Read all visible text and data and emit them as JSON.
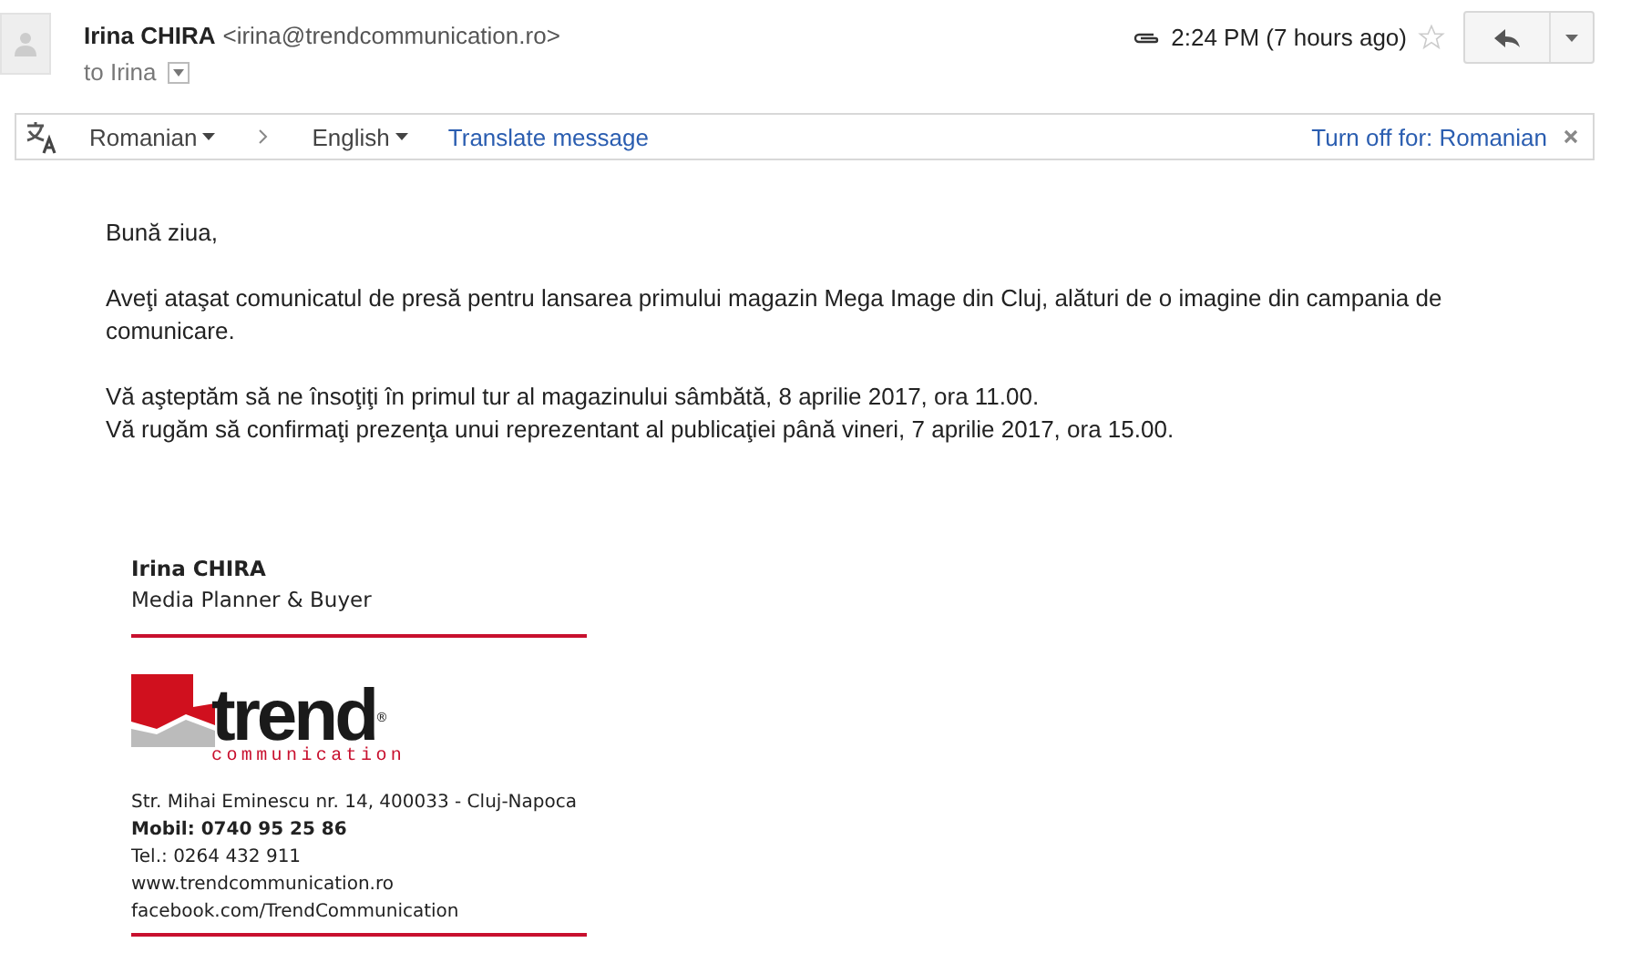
{
  "header": {
    "sender_name": "Irina CHIRA",
    "sender_email": "<irina@trendcommunication.ro>",
    "recipient": "to Irina",
    "has_attachment": true,
    "time": "2:24 PM (7 hours ago)",
    "starred": false
  },
  "translate_bar": {
    "source_language": "Romanian",
    "target_language": "English",
    "translate_link": "Translate message",
    "turn_off_link": "Turn off for: Romanian"
  },
  "body": [
    "Bună ziua,",
    "Aveţi ataşat comunicatul de presă pentru lansarea primului magazin Mega Image din Cluj, alături de o imagine din campania de comunicare.",
    [
      "Vă aşteptăm să ne însoţiţi în primul tur al magazinului sâmbătă, 8 aprilie 2017, ora 11.00.",
      "Vă rugăm să confirmaţi prezenţa unui reprezentant al publicaţiei până vineri, 7 aprilie 2017, ora 15.00."
    ]
  ],
  "signature": {
    "name": "Irina CHIRA",
    "role": "Media Planner & Buyer",
    "logo_word": "trend",
    "logo_sub": "communication",
    "logo_mark": "®",
    "lines": [
      {
        "text": "Str. Mihai Eminescu nr. 14, 400033 - Cluj-Napoca",
        "bold": false
      },
      {
        "text": "Mobil: 0740 95 25 86",
        "bold": true
      },
      {
        "text": "Tel.: 0264 432 911",
        "bold": false
      },
      {
        "text": "www.trendcommunication.ro",
        "bold": false
      },
      {
        "text": "facebook.com/TrendCommunication",
        "bold": false
      }
    ]
  }
}
